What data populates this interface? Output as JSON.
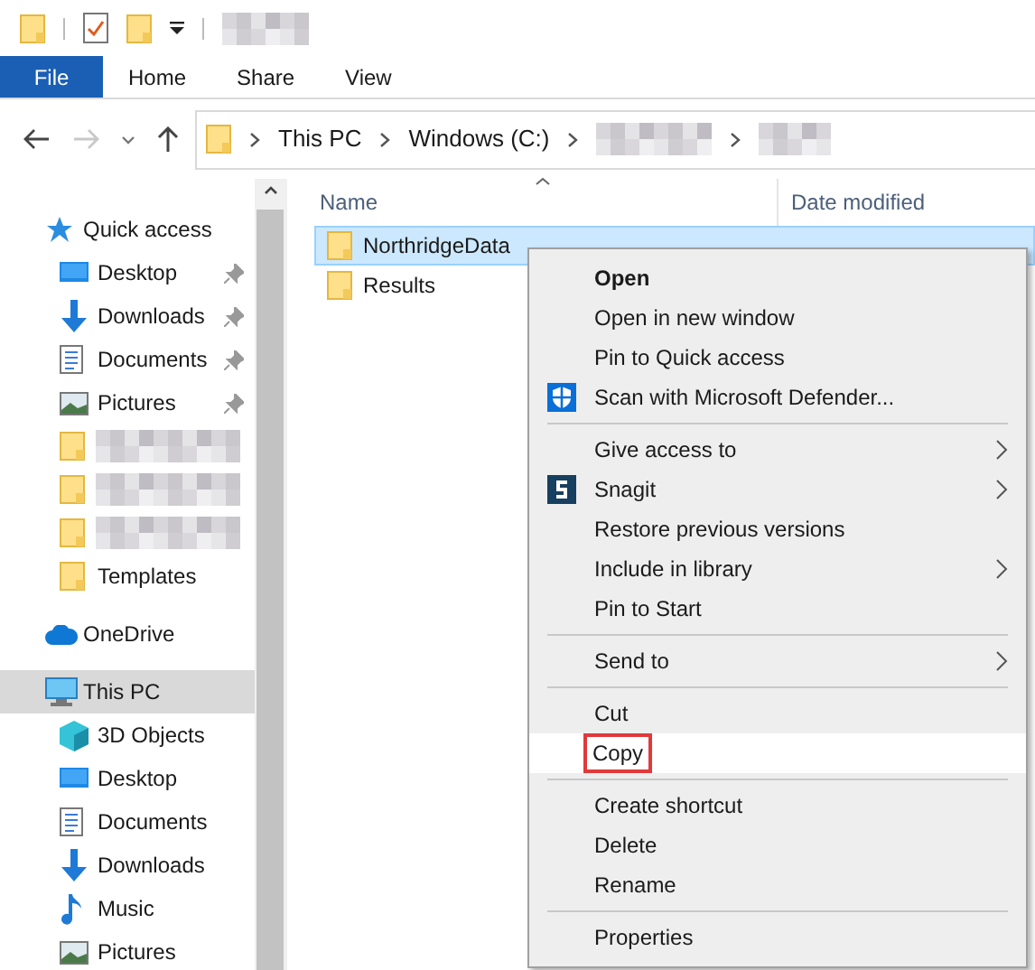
{
  "quick_toolbar": {
    "items": [
      {
        "kind": "folder"
      },
      {
        "kind": "properties"
      },
      {
        "kind": "new-folder"
      },
      {
        "kind": "customize"
      }
    ],
    "title": {
      "kind": "redacted"
    }
  },
  "ribbon": {
    "tabs": [
      {
        "label": "File",
        "kind": "file"
      },
      {
        "label": "Home",
        "kind": "tab"
      },
      {
        "label": "Share",
        "kind": "tab"
      },
      {
        "label": "View",
        "kind": "tab"
      }
    ]
  },
  "address_bar": {
    "forward_disabled": true,
    "segments": [
      {
        "kind": "text",
        "label": "This PC"
      },
      {
        "kind": "text",
        "label": "Windows (C:)"
      },
      {
        "kind": "redacted"
      },
      {
        "kind": "redacted"
      }
    ]
  },
  "navigation_pane": {
    "items": [
      {
        "kind": "quick-access",
        "label": "Quick access",
        "selected": false,
        "children": [
          {
            "kind": "desktop",
            "label": "Desktop",
            "pinned": true,
            "selected": false
          },
          {
            "kind": "downloads",
            "label": "Downloads",
            "pinned": true,
            "selected": false
          },
          {
            "kind": "documents",
            "label": "Documents",
            "pinned": true,
            "selected": false
          },
          {
            "kind": "pictures",
            "label": "Pictures",
            "pinned": true,
            "selected": false
          },
          {
            "kind": "redacted-folder",
            "pinned": false,
            "selected": false
          },
          {
            "kind": "redacted-folder",
            "pinned": false,
            "selected": false
          },
          {
            "kind": "redacted-folder",
            "pinned": false,
            "selected": false
          },
          {
            "kind": "folder",
            "label": "Templates",
            "pinned": false,
            "selected": false
          }
        ]
      },
      {
        "kind": "cloud",
        "label": "OneDrive",
        "selected": false
      },
      {
        "kind": "pc",
        "label": "This PC",
        "selected": true,
        "children": [
          {
            "kind": "objects",
            "label": "3D Objects",
            "pinned": false,
            "selected": false
          },
          {
            "kind": "desktop",
            "label": "Desktop",
            "pinned": false,
            "selected": false
          },
          {
            "kind": "documents",
            "label": "Documents",
            "pinned": false,
            "selected": false
          },
          {
            "kind": "downloads",
            "label": "Downloads",
            "pinned": false,
            "selected": false
          },
          {
            "kind": "music",
            "label": "Music",
            "pinned": false,
            "selected": false
          },
          {
            "kind": "pictures",
            "label": "Pictures",
            "pinned": false,
            "selected": false
          }
        ]
      }
    ]
  },
  "file_list": {
    "columns": [
      "Name",
      "Date modified"
    ],
    "rows": [
      {
        "name": "NorthridgeData",
        "selected": true
      },
      {
        "name": "Results",
        "selected": false
      }
    ]
  },
  "context_menu": {
    "groups": [
      [
        {
          "label": "Open",
          "kind": "plain",
          "default": true,
          "submenu": false,
          "selected": false,
          "outlined": false
        },
        {
          "label": "Open in new window",
          "kind": "plain",
          "default": false,
          "submenu": false,
          "selected": false,
          "outlined": false
        },
        {
          "label": "Pin to Quick access",
          "kind": "plain",
          "default": false,
          "submenu": false,
          "selected": false,
          "outlined": false
        },
        {
          "label": "Scan with Microsoft Defender...",
          "kind": "defender",
          "default": false,
          "submenu": false,
          "selected": false,
          "outlined": false
        }
      ],
      [
        {
          "label": "Give access to",
          "kind": "plain",
          "default": false,
          "submenu": true,
          "selected": false,
          "outlined": false
        },
        {
          "label": "Snagit",
          "kind": "snagit",
          "default": false,
          "submenu": true,
          "selected": false,
          "outlined": false
        },
        {
          "label": "Restore previous versions",
          "kind": "plain",
          "default": false,
          "submenu": false,
          "selected": false,
          "outlined": false
        },
        {
          "label": "Include in library",
          "kind": "plain",
          "default": false,
          "submenu": true,
          "selected": false,
          "outlined": false
        },
        {
          "label": "Pin to Start",
          "kind": "plain",
          "default": false,
          "submenu": false,
          "selected": false,
          "outlined": false
        }
      ],
      [
        {
          "label": "Send to",
          "kind": "plain",
          "default": false,
          "submenu": true,
          "selected": false,
          "outlined": false
        }
      ],
      [
        {
          "label": "Cut",
          "kind": "plain",
          "default": false,
          "submenu": false,
          "selected": false,
          "outlined": false
        },
        {
          "label": "Copy",
          "kind": "plain",
          "default": false,
          "submenu": false,
          "selected": true,
          "outlined": true
        }
      ],
      [
        {
          "label": "Create shortcut",
          "kind": "plain",
          "default": false,
          "submenu": false,
          "selected": false,
          "outlined": false
        },
        {
          "label": "Delete",
          "kind": "plain",
          "default": false,
          "submenu": false,
          "selected": false,
          "outlined": false
        },
        {
          "label": "Rename",
          "kind": "plain",
          "default": false,
          "submenu": false,
          "selected": false,
          "outlined": false
        }
      ],
      [
        {
          "label": "Properties",
          "kind": "plain",
          "default": false,
          "submenu": false,
          "selected": false,
          "outlined": false
        }
      ]
    ]
  }
}
